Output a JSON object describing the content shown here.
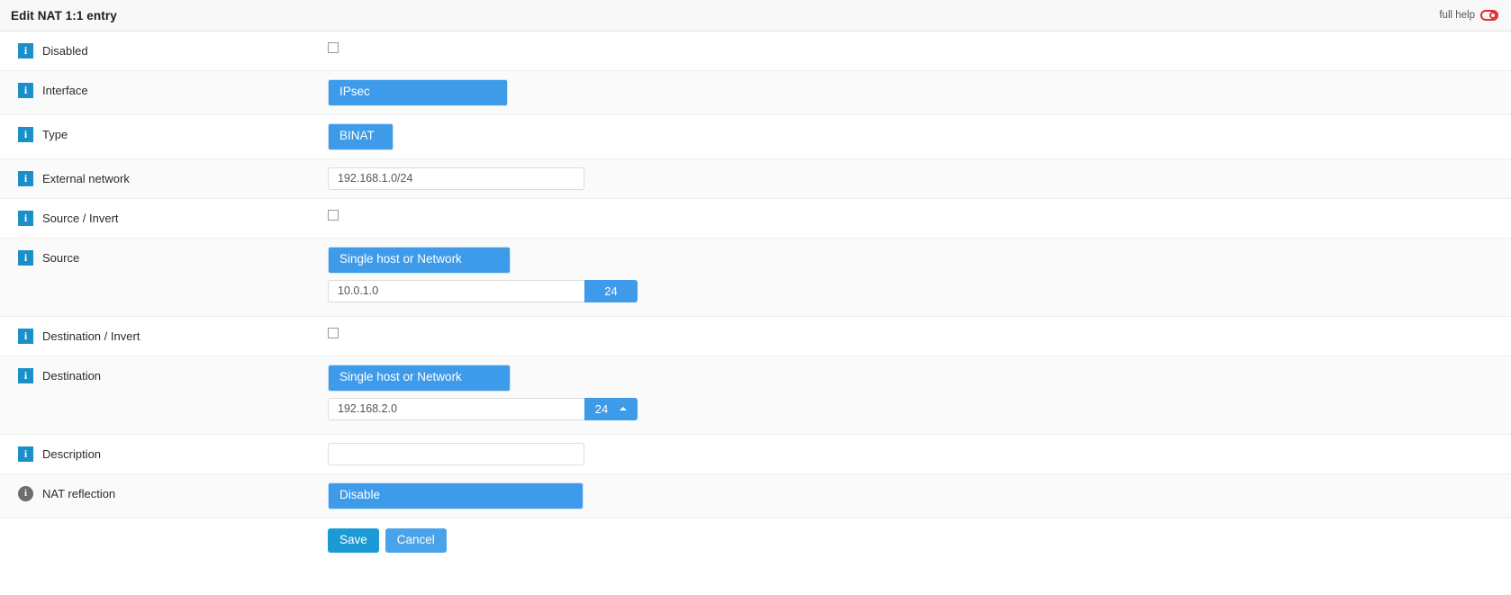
{
  "header": {
    "title": "Edit NAT 1:1 entry",
    "help_label": "full help",
    "help_toggle_icon": "toggle-off-icon",
    "help_toggle_color": "#e02b36"
  },
  "theme": {
    "select_blue": "#3d9be9",
    "info_icon_blue": "#1b8fc9",
    "info_icon_grey": "#6d6d6d",
    "save_blue": "#1b9ad6",
    "cancel_blue": "#4aa3e8",
    "row_alt_bg": "#fafafa"
  },
  "icons": {
    "info_square": "i",
    "info_round": "i"
  },
  "rows": {
    "disabled": {
      "label": "Disabled",
      "icon": "info-icon",
      "checkbox_checked": false
    },
    "interface": {
      "label": "Interface",
      "icon": "info-icon",
      "value": "IPsec"
    },
    "type": {
      "label": "Type",
      "icon": "info-icon",
      "value": "BINAT"
    },
    "external_network": {
      "label": "External network",
      "icon": "info-icon",
      "value": "192.168.1.0/24",
      "placeholder": ""
    },
    "source_invert": {
      "label": "Source / Invert",
      "icon": "info-icon",
      "checkbox_checked": false
    },
    "source": {
      "label": "Source",
      "icon": "info-icon",
      "type_value": "Single host or Network",
      "address_value": "10.0.1.0",
      "cidr_value": "24",
      "cidr_caret": "caret-up-icon",
      "caret_visible": false
    },
    "destination_invert": {
      "label": "Destination / Invert",
      "icon": "info-icon",
      "checkbox_checked": false
    },
    "destination": {
      "label": "Destination",
      "icon": "info-icon",
      "type_value": "Single host or Network",
      "address_value": "192.168.2.0",
      "cidr_value": "24",
      "cidr_caret": "caret-up-icon",
      "caret_visible": true
    },
    "description": {
      "label": "Description",
      "icon": "info-icon",
      "value": "",
      "placeholder": ""
    },
    "nat_reflection": {
      "label": "NAT reflection",
      "icon": "info-circle-icon",
      "value": "Disable"
    }
  },
  "footer": {
    "save_label": "Save",
    "cancel_label": "Cancel"
  }
}
